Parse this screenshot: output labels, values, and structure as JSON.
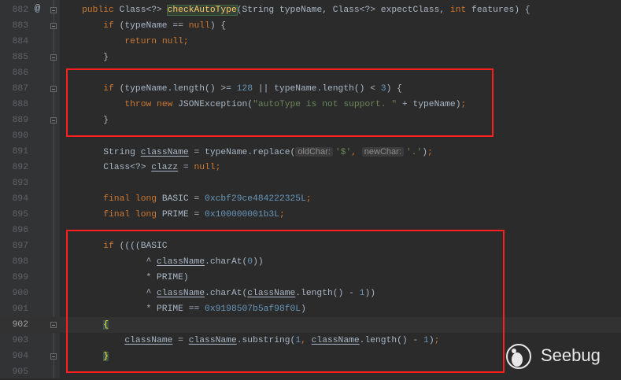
{
  "editor": {
    "current_line": "902",
    "lines": [
      {
        "n": "882",
        "tokens": [
          [
            "plain",
            "    "
          ],
          [
            "kw",
            "public "
          ],
          [
            "plain",
            "Class<?> "
          ],
          [
            "decl",
            "checkAutoType"
          ],
          [
            "plain",
            "(String typeName, Class<?> expectClass, "
          ],
          [
            "kw",
            "int "
          ],
          [
            "plain",
            "features) {"
          ]
        ]
      },
      {
        "n": "883",
        "tokens": [
          [
            "plain",
            "        "
          ],
          [
            "kw",
            "if "
          ],
          [
            "plain",
            "(typeName == "
          ],
          [
            "kw",
            "null"
          ],
          [
            "plain",
            ") {"
          ]
        ]
      },
      {
        "n": "884",
        "tokens": [
          [
            "plain",
            "            "
          ],
          [
            "kw",
            "return null;"
          ]
        ]
      },
      {
        "n": "885",
        "tokens": [
          [
            "plain",
            "        }"
          ]
        ]
      },
      {
        "n": "886",
        "tokens": []
      },
      {
        "n": "887",
        "tokens": [
          [
            "plain",
            "        "
          ],
          [
            "kw",
            "if "
          ],
          [
            "plain",
            "(typeName.length() >= "
          ],
          [
            "num",
            "128"
          ],
          [
            "plain",
            " || typeName.length() < "
          ],
          [
            "num",
            "3"
          ],
          [
            "plain",
            ") {"
          ]
        ]
      },
      {
        "n": "888",
        "tokens": [
          [
            "plain",
            "            "
          ],
          [
            "kw",
            "throw new "
          ],
          [
            "plain",
            "JSONException("
          ],
          [
            "str",
            "\"autoType is not support. \""
          ],
          [
            "plain",
            " + typeName)"
          ],
          [
            "kw",
            ";"
          ]
        ]
      },
      {
        "n": "889",
        "tokens": [
          [
            "plain",
            "        }"
          ]
        ]
      },
      {
        "n": "890",
        "tokens": []
      },
      {
        "n": "891",
        "tokens": [
          [
            "plain",
            "        String "
          ],
          [
            "ul",
            "className"
          ],
          [
            "plain",
            " = typeName.replace("
          ],
          [
            "hint",
            "oldChar:"
          ],
          [
            "str",
            "'$'"
          ],
          [
            "kw",
            ", "
          ],
          [
            "hint",
            "newChar:"
          ],
          [
            "str",
            "'.'"
          ],
          [
            "plain",
            ")"
          ],
          [
            "kw",
            ";"
          ]
        ]
      },
      {
        "n": "892",
        "tokens": [
          [
            "plain",
            "        Class<?> "
          ],
          [
            "ul",
            "clazz"
          ],
          [
            "plain",
            " = "
          ],
          [
            "kw",
            "null;"
          ]
        ]
      },
      {
        "n": "893",
        "tokens": []
      },
      {
        "n": "894",
        "tokens": [
          [
            "plain",
            "        "
          ],
          [
            "kw",
            "final long "
          ],
          [
            "plain",
            "BASIC = "
          ],
          [
            "num",
            "0xcbf29ce484222325L"
          ],
          [
            "kw",
            ";"
          ]
        ]
      },
      {
        "n": "895",
        "tokens": [
          [
            "plain",
            "        "
          ],
          [
            "kw",
            "final long "
          ],
          [
            "plain",
            "PRIME = "
          ],
          [
            "num",
            "0x100000001b3L"
          ],
          [
            "kw",
            ";"
          ]
        ]
      },
      {
        "n": "896",
        "tokens": []
      },
      {
        "n": "897",
        "tokens": [
          [
            "plain",
            "        "
          ],
          [
            "kw",
            "if "
          ],
          [
            "plain",
            "((((BASIC"
          ]
        ]
      },
      {
        "n": "898",
        "tokens": [
          [
            "plain",
            "                ^ "
          ],
          [
            "ul",
            "className"
          ],
          [
            "plain",
            ".charAt("
          ],
          [
            "num",
            "0"
          ],
          [
            "plain",
            "))"
          ]
        ]
      },
      {
        "n": "899",
        "tokens": [
          [
            "plain",
            "                * PRIME)"
          ]
        ]
      },
      {
        "n": "900",
        "tokens": [
          [
            "plain",
            "                ^ "
          ],
          [
            "ul",
            "className"
          ],
          [
            "plain",
            ".charAt("
          ],
          [
            "ul",
            "className"
          ],
          [
            "plain",
            ".length() - "
          ],
          [
            "num",
            "1"
          ],
          [
            "plain",
            "))"
          ]
        ]
      },
      {
        "n": "901",
        "tokens": [
          [
            "plain",
            "                * PRIME == "
          ],
          [
            "num",
            "0x9198507b5af98f0L"
          ],
          [
            "plain",
            ")"
          ]
        ]
      },
      {
        "n": "902",
        "tokens": [
          [
            "plain",
            "        "
          ],
          [
            "brace",
            "{"
          ]
        ]
      },
      {
        "n": "903",
        "tokens": [
          [
            "plain",
            "            "
          ],
          [
            "ul",
            "className"
          ],
          [
            "plain",
            " = "
          ],
          [
            "ul",
            "className"
          ],
          [
            "plain",
            ".substring("
          ],
          [
            "num",
            "1"
          ],
          [
            "kw",
            ", "
          ],
          [
            "ul",
            "className"
          ],
          [
            "plain",
            ".length() - "
          ],
          [
            "num",
            "1"
          ],
          [
            "plain",
            ")"
          ],
          [
            "kw",
            ";"
          ]
        ]
      },
      {
        "n": "904",
        "tokens": [
          [
            "plain",
            "        "
          ],
          [
            "brace",
            "}"
          ]
        ]
      },
      {
        "n": "905",
        "tokens": []
      }
    ]
  },
  "gutter": {
    "override_marker": "@"
  },
  "watermark": {
    "brand": "Seebug"
  },
  "colors": {
    "highlight_box": "#ff1f1f",
    "background": "#2b2b2b",
    "keyword": "#cc7832",
    "number": "#6897bb",
    "string": "#6a8759"
  }
}
